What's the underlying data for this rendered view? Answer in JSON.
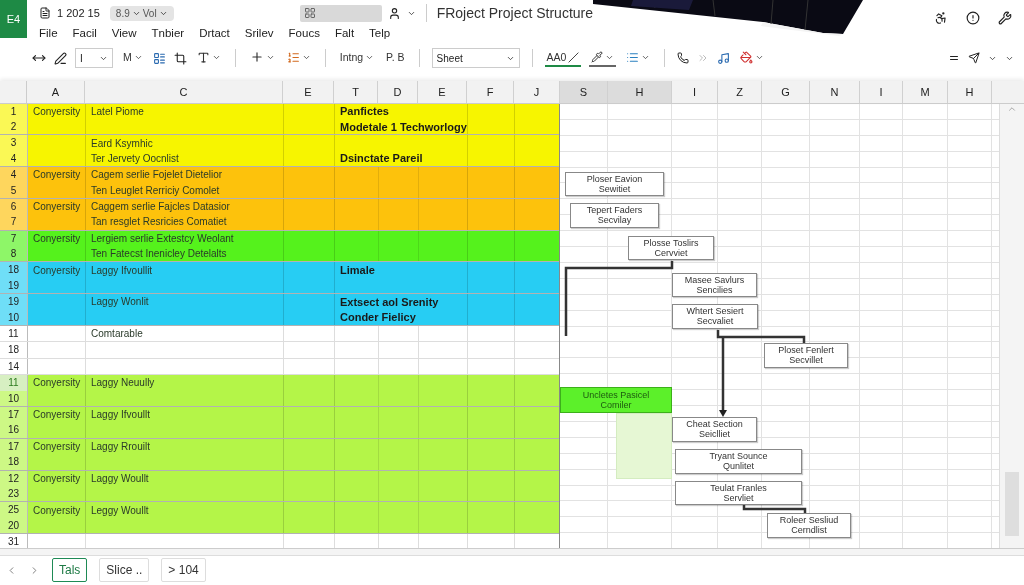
{
  "app": {
    "badge": "E4",
    "quick_access": "1 202 15",
    "version": "8.9",
    "mode": "Vol",
    "title": "FRoject Project Structure"
  },
  "menu": [
    "File",
    "Facil",
    "View",
    "Tnbier",
    "Drtact",
    "Srilev",
    "Foucs",
    "Falt",
    "Telp"
  ],
  "toolbar": {
    "font": "I",
    "style": "M",
    "format": "Intng",
    "paragraph": "P. B",
    "sheet": "Sheet",
    "text_tool": "AA0"
  },
  "columns": [
    {
      "label": "A",
      "selected": false
    },
    {
      "label": "C",
      "selected": false
    },
    {
      "label": "E",
      "selected": false
    },
    {
      "label": "T",
      "selected": false
    },
    {
      "label": "D",
      "selected": false
    },
    {
      "label": "E",
      "selected": false
    },
    {
      "label": "F",
      "selected": false
    },
    {
      "label": "J",
      "selected": false
    },
    {
      "label": "S",
      "selected": true
    },
    {
      "label": "H",
      "selected": true
    },
    {
      "label": "I",
      "selected": false
    },
    {
      "label": "Z",
      "selected": false
    },
    {
      "label": "G",
      "selected": false
    },
    {
      "label": "N",
      "selected": false
    },
    {
      "label": "I",
      "selected": false
    },
    {
      "label": "M",
      "selected": false
    },
    {
      "label": "H",
      "selected": false
    }
  ],
  "bands": [
    {
      "color": "#f7f500",
      "blocks": [
        [
          {
            "number": "1",
            "selected": false,
            "a": "Conyersity",
            "c": "Latel Piome",
            "td": "Panfictes"
          },
          {
            "number": "2",
            "selected": false,
            "td": "Modetale 1 Techworlogy"
          }
        ],
        [
          {
            "number": "3",
            "selected": false,
            "c": "Eard Ksymhic"
          },
          {
            "number": "4",
            "selected": false,
            "c": "Ter Jervety Oocnlist",
            "td": "Dsinctate Pareil"
          }
        ]
      ]
    },
    {
      "color": "#fdc20c",
      "blocks": [
        [
          {
            "number": "4",
            "selected": false,
            "a": "Conyersity",
            "c": "Cagem serlie Fojelet Dietelior"
          },
          {
            "number": "5",
            "selected": false,
            "c": "Ten Leuglet Rerriciy Comolet"
          }
        ],
        [
          {
            "number": "6",
            "selected": false,
            "a": "Conyersity",
            "c": "Caggem serlie Fajcles Datasior"
          },
          {
            "number": "7",
            "selected": false,
            "c": "Tan resglet Resricies Comatiet"
          }
        ]
      ]
    },
    {
      "color": "#55f21c",
      "blocks": [
        [
          {
            "number": "7",
            "selected": false,
            "a": "Conyersity",
            "c": "Lergiem serlie Extestcy Weolant"
          },
          {
            "number": "8",
            "selected": false,
            "c": "Ten Fatecst Inenicley Detelalts"
          }
        ]
      ]
    },
    {
      "color": "#27cdf3",
      "blocks": [
        [
          {
            "number": "18",
            "selected": false,
            "a": "Conyersity",
            "c": "Laggy Ifvoullit",
            "td": "Limale"
          },
          {
            "number": "19",
            "selected": false
          }
        ],
        [
          {
            "number": "19",
            "selected": false,
            "c": "Laggy Wonlit",
            "td": "Extsect aol Srenity"
          },
          {
            "number": "10",
            "selected": false,
            "td": "Conder Fielicy"
          }
        ]
      ]
    },
    {
      "color": "#ffffff",
      "blocks": [
        [
          {
            "number": "11",
            "selected": false,
            "c": "Comtarable"
          }
        ],
        [
          {
            "number": "18",
            "selected": false
          }
        ],
        [
          {
            "number": "14",
            "selected": false
          }
        ]
      ]
    },
    {
      "color": "#b4f548",
      "blocks": [
        [
          {
            "number": "11",
            "selected": true,
            "a": "Conyersity",
            "c": "Laggy Neuully"
          },
          {
            "number": "10",
            "selected": false
          }
        ],
        [
          {
            "number": "17",
            "selected": false,
            "a": "Conyersity",
            "c": "Laggy Ifvoullt"
          },
          {
            "number": "16",
            "selected": false
          }
        ],
        [
          {
            "number": "17",
            "selected": false,
            "a": "Conyersity",
            "c": "Laggy Rrouilt"
          },
          {
            "number": "18",
            "selected": false
          }
        ],
        [
          {
            "number": "12",
            "selected": false,
            "a": "Conyersity",
            "c": "Laggy Woullt"
          },
          {
            "number": "23",
            "selected": false
          }
        ],
        [
          {
            "number": "25",
            "selected": false,
            "a": "Conyersity",
            "c": "Leggy Woullt"
          },
          {
            "number": "20",
            "selected": false
          }
        ]
      ]
    },
    {
      "color": "#ffffff",
      "blocks": [
        [
          {
            "number": "31",
            "selected": false
          }
        ]
      ]
    }
  ],
  "diagram": [
    {
      "kind": "box",
      "lines": [
        "Ploser Eavion",
        "Sewitiet"
      ]
    },
    {
      "kind": "box",
      "lines": [
        "Tepert Faders",
        "Secvilay"
      ]
    },
    {
      "kind": "box",
      "lines": [
        "Plosse Toslirs",
        "Cervviet"
      ]
    },
    {
      "kind": "box",
      "lines": [
        "Masee Savlurs",
        "Sencilies"
      ]
    },
    {
      "kind": "box",
      "lines": [
        "Whtert Sesiert",
        "Secvaliet"
      ]
    },
    {
      "kind": "box",
      "lines": [
        "Ploset Fenlert",
        "Secvillet"
      ]
    },
    {
      "kind": "cell",
      "lines": [
        "Uncletes Pasicel",
        "Comiler"
      ]
    },
    {
      "kind": "box",
      "lines": [
        "Cheat Section",
        "Seiclliet"
      ]
    },
    {
      "kind": "box",
      "lines": [
        "Tryant Sounce",
        "Qunlitet"
      ]
    },
    {
      "kind": "box",
      "lines": [
        "Teulat Franles",
        "Servliet"
      ]
    },
    {
      "kind": "box",
      "lines": [
        "Roleer Sesliud",
        "Cerndlist"
      ]
    }
  ],
  "sheet_tabs": [
    {
      "label": "Tals",
      "selected": true
    },
    {
      "label": "Slice ..",
      "selected": false
    },
    {
      "label": "> 104",
      "selected": false
    }
  ]
}
